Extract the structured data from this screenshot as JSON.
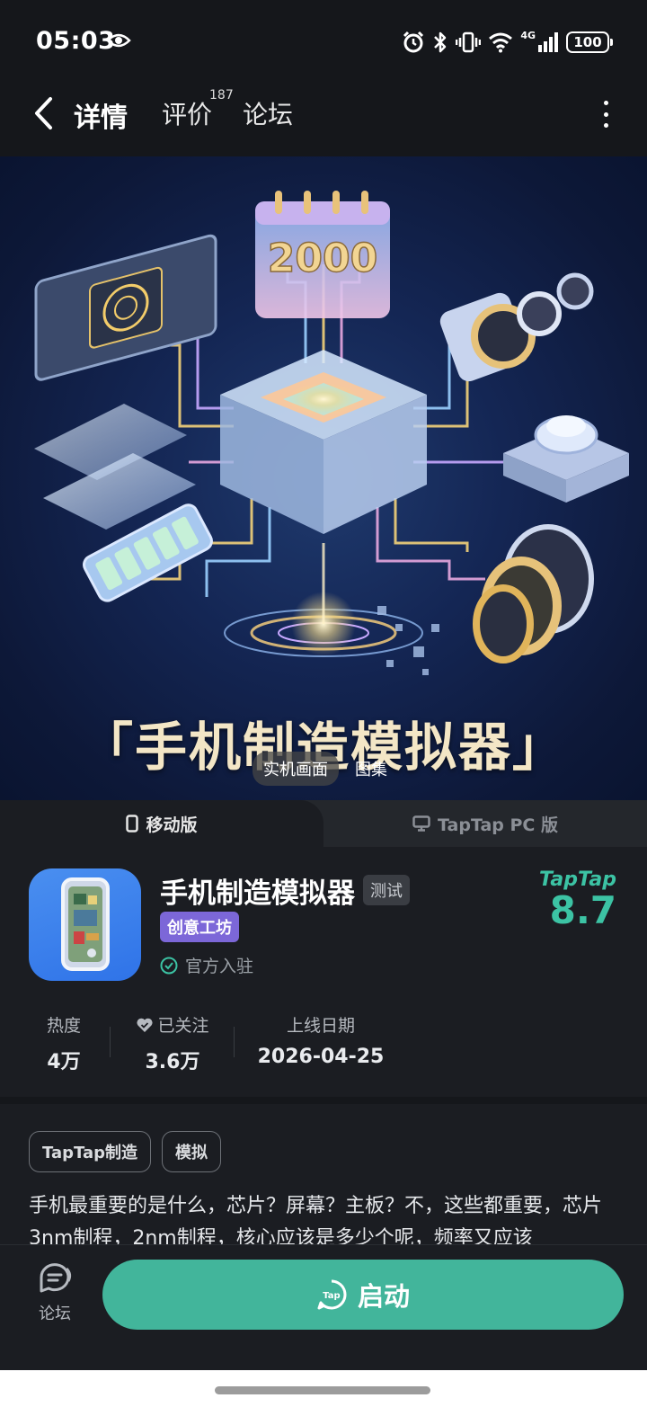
{
  "status_bar": {
    "time": "05:03",
    "network": "4G",
    "battery": "100",
    "icons": [
      "eye-icon",
      "alarm-icon",
      "bluetooth-icon",
      "vibrate-icon",
      "wifi-icon",
      "signal-icon",
      "battery-icon"
    ]
  },
  "nav": {
    "tabs": [
      {
        "label": "详情",
        "active": true
      },
      {
        "label": "评价",
        "count": "187"
      },
      {
        "label": "论坛"
      }
    ]
  },
  "hero": {
    "title": "「手机制造模拟器」",
    "calendar_number": "2000",
    "chip_live": "实机画面",
    "chip_gallery": "图集"
  },
  "platform": {
    "mobile_label": "移动版",
    "pc_label": "TapTap PC 版"
  },
  "app": {
    "name": "手机制造模拟器",
    "badge_test": "测试",
    "badge_creative": "创意工坊",
    "official_label": "官方入驻",
    "score_brand": "TapTap",
    "score": "8.7",
    "accent_color": "#3cc3a4"
  },
  "stats": [
    {
      "label": "热度",
      "value": "4万"
    },
    {
      "label": "已关注",
      "value": "3.6万"
    },
    {
      "label": "上线日期",
      "value": "2026-04-25"
    }
  ],
  "description": {
    "tags": [
      "TapTap制造",
      "模拟"
    ],
    "text": "手机最重要的是什么，芯片？屏幕？主板？不，这些都重要，芯片3nm制程，2nm制程，核心应该是多少个呢，频率又应该"
  },
  "bottom": {
    "forum_label": "论坛",
    "start_label": "启动",
    "start_color": "#42b59b"
  }
}
